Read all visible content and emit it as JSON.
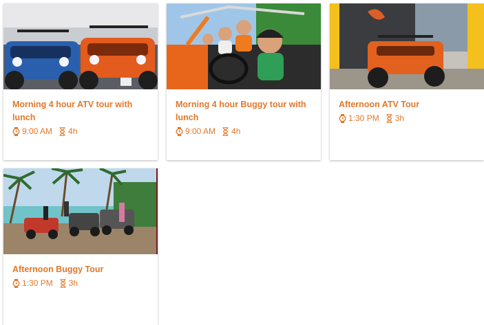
{
  "tours": [
    {
      "title": "Morning 4 hour ATV tour with lunch",
      "time": "9:00 AM",
      "duration": "4h"
    },
    {
      "title": "Morning 4 hour Buggy tour with lunch",
      "time": "9:00 AM",
      "duration": "4h"
    },
    {
      "title": "Afternoon ATV Tour",
      "time": "1:30 PM",
      "duration": "3h"
    },
    {
      "title": "Afternoon Buggy Tour",
      "time": "1:30 PM",
      "duration": "3h"
    }
  ],
  "colors": {
    "accent": "#e0782a"
  }
}
